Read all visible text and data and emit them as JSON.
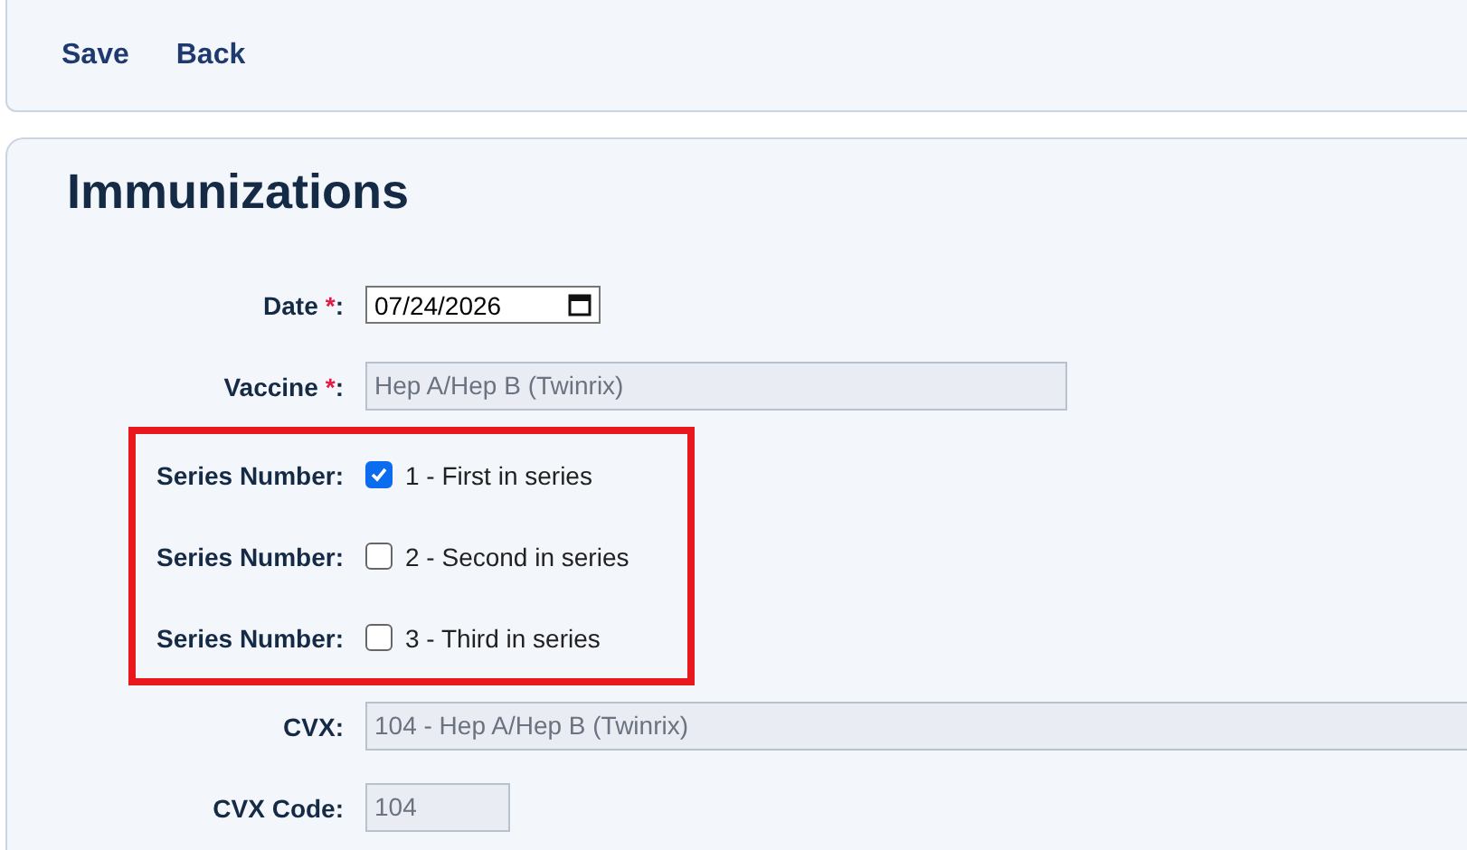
{
  "toolbar": {
    "buttons": [
      "Save",
      "Back"
    ]
  },
  "title": "Immunizations",
  "fields": [
    {
      "kind": "date",
      "label": "Date",
      "required_mark": "*",
      "label_end": ":",
      "value": "07/24/2026"
    },
    {
      "kind": "readonly",
      "label": "Vaccine",
      "required_mark": "*",
      "label_end": ":",
      "value": "Hep A/Hep B (Twinrix)"
    }
  ],
  "series_group": {
    "highlighted": true,
    "rows": [
      {
        "label": "Series Number:",
        "option": "1 - First in series",
        "checked": true
      },
      {
        "label": "Series Number:",
        "option": "2 - Second in series",
        "checked": false
      },
      {
        "label": "Series Number:",
        "option": "3 - Third in series",
        "checked": false
      }
    ]
  },
  "fields_after": [
    {
      "kind": "readonly",
      "label": "CVX:",
      "value": "104 - Hep A/Hep B (Twinrix)"
    },
    {
      "kind": "readonly",
      "label": "CVX Code:",
      "value": "104"
    }
  ]
}
